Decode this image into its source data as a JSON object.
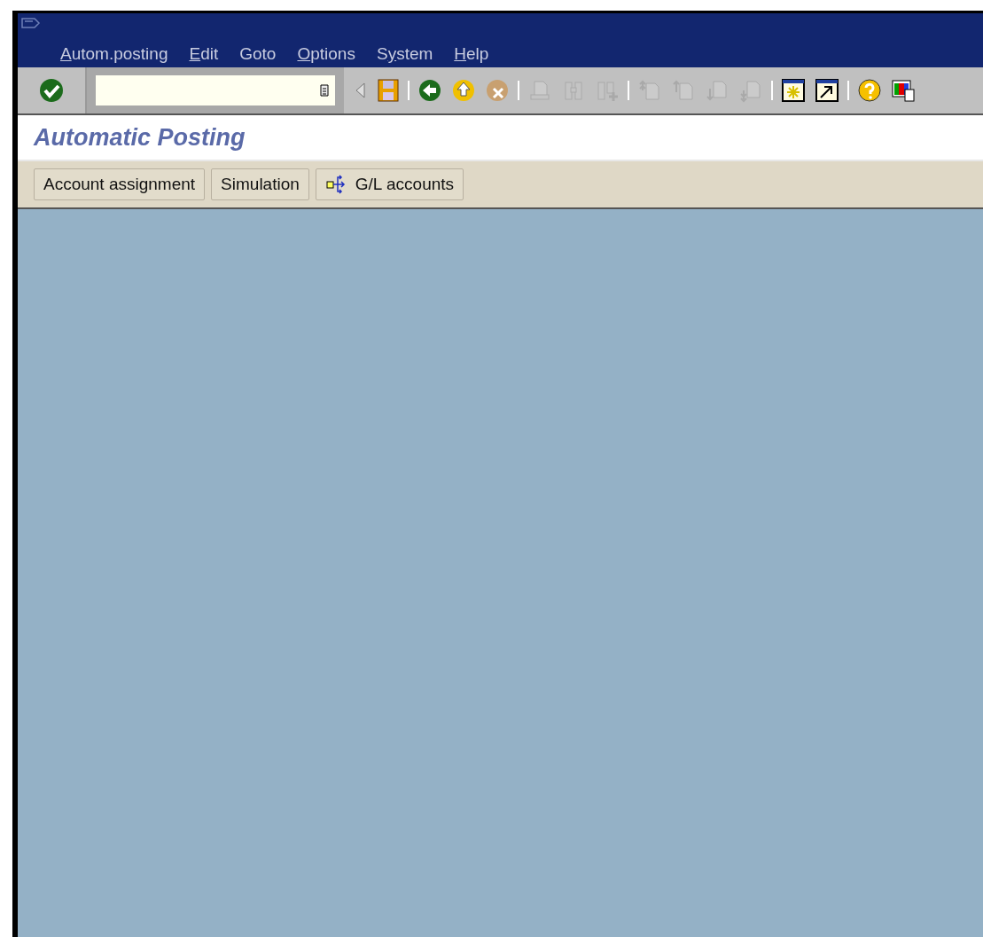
{
  "menu": [
    {
      "key": "A",
      "rest": "utom.posting"
    },
    {
      "key": "E",
      "rest": "dit"
    },
    {
      "rest": "Goto"
    },
    {
      "key": "O",
      "rest": "ptions"
    },
    {
      "lead": "S",
      "key": "y",
      "rest": "stem"
    },
    {
      "key": "H",
      "rest": "elp"
    }
  ],
  "toolbar": [
    {
      "disabled": false
    },
    {
      "disabled": false
    },
    {
      "disabled": false
    },
    {
      "disabled": false
    },
    {
      "disabled": false
    },
    {
      "disabled": true
    },
    {
      "disabled": true
    },
    {
      "disabled": true
    },
    {
      "disabled": true
    },
    {
      "disabled": true
    },
    {
      "disabled": true
    },
    {
      "disabled": true
    },
    {
      "disabled": false
    },
    {
      "disabled": false
    },
    {
      "disabled": false
    },
    {
      "disabled": false
    }
  ],
  "screen_title": "Automatic Posting",
  "app_buttons": [
    {
      "label": "Account assignment"
    },
    {
      "label": "Simulation"
    },
    {
      "label": "G/L accounts",
      "kind": "icon"
    }
  ]
}
